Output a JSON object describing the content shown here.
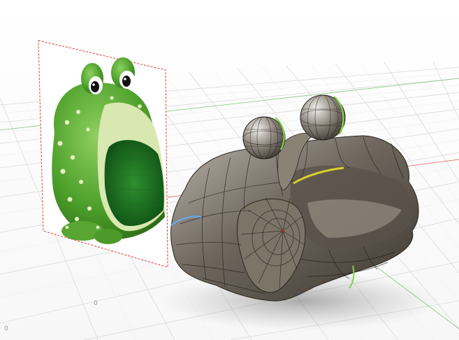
{
  "viewport": {
    "tick_labels": [
      "0",
      "0"
    ]
  },
  "colors": {
    "background": "#ffffff",
    "grid_line": "#d9d9d9",
    "axis_red": "#e05050",
    "axis_green": "#4ab04a",
    "canvas_border": "#e23b3b",
    "frog_green": "#5fb03a",
    "frog_dark": "#2f7a1e",
    "mesh_surface": "#8a8073",
    "edge_highlight_green": "#7fd24a",
    "edge_highlight_yellow": "#d8d02a",
    "edge_highlight_blue": "#6aa6e0"
  },
  "icons": {
    "reference_image": "frog-sponge-holder-photo",
    "model": "tspline-frog-mesh"
  }
}
